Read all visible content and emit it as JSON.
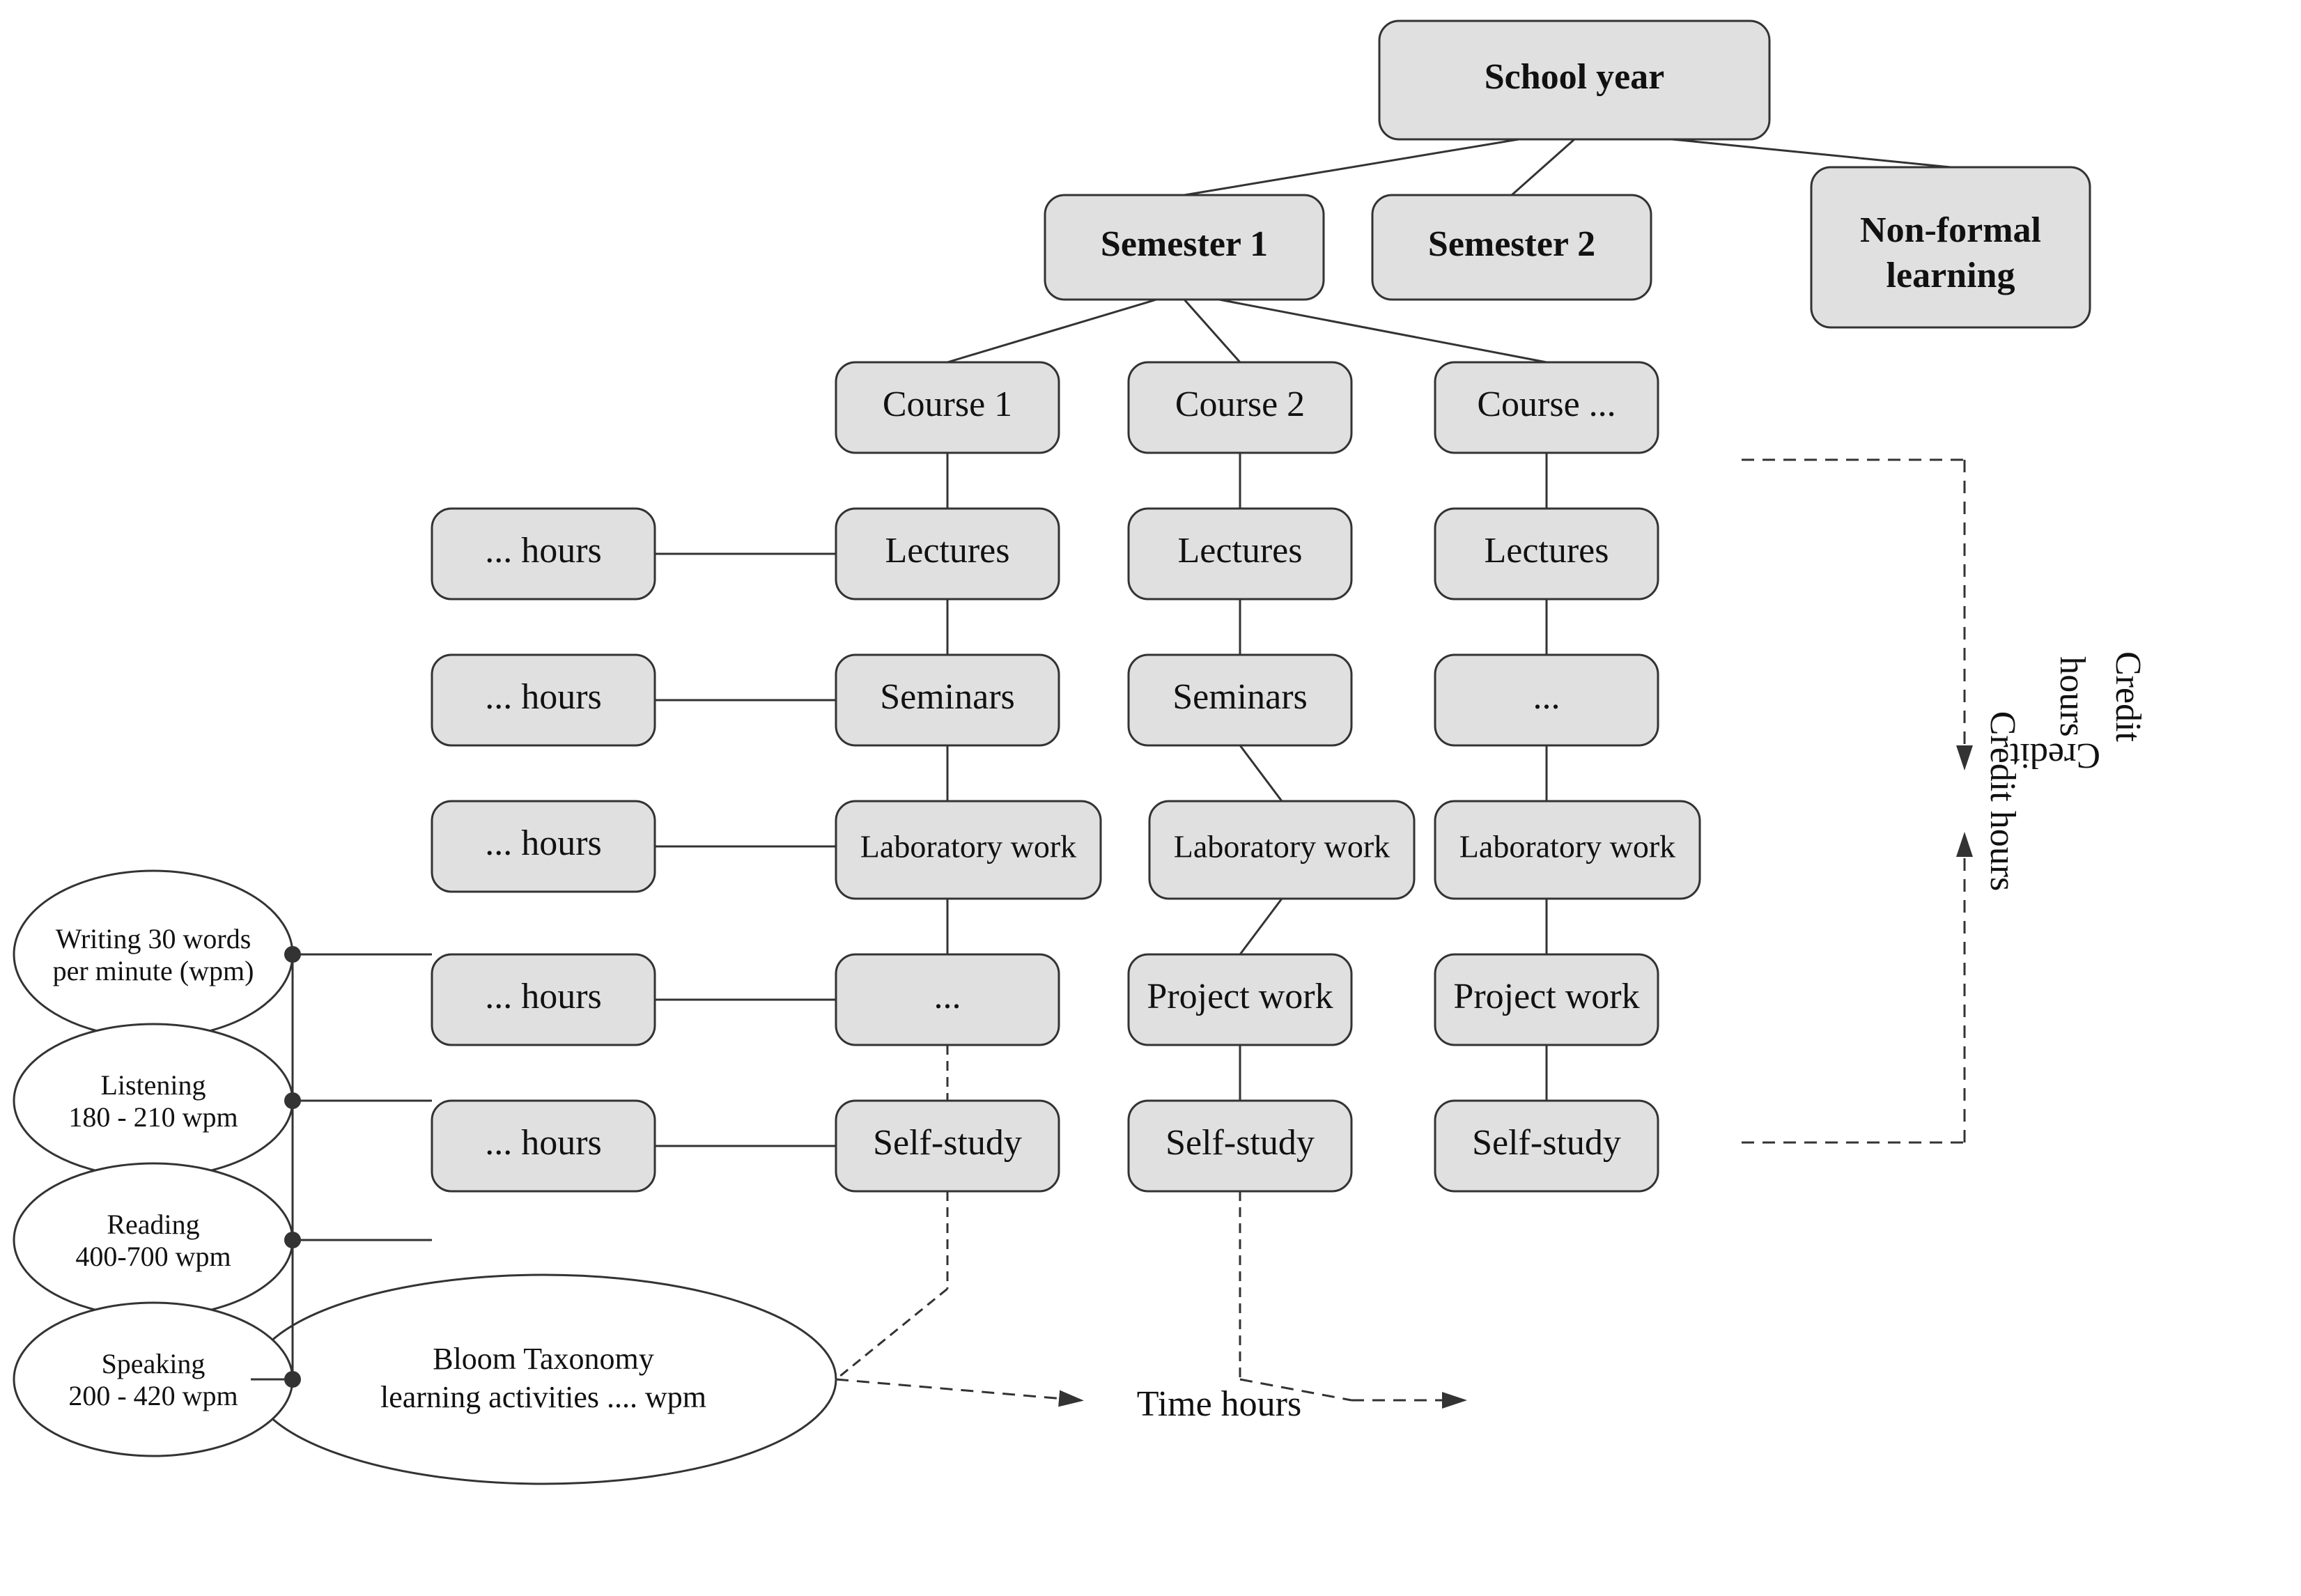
{
  "diagram": {
    "title": "School year",
    "nodes": {
      "school_year": {
        "label": "School year",
        "bold": true
      },
      "semester1": {
        "label": "Semester 1",
        "bold": true
      },
      "semester2": {
        "label": "Semester 2",
        "bold": true
      },
      "nonformal": {
        "label": "Non-formal\nlearning",
        "bold": true
      },
      "course1": {
        "label": "Course 1"
      },
      "course2": {
        "label": "Course 2"
      },
      "courseN": {
        "label": "Course ..."
      },
      "lectures1": {
        "label": "Lectures"
      },
      "lectures2": {
        "label": "Lectures"
      },
      "lecturesN": {
        "label": "Lectures"
      },
      "seminars1": {
        "label": "Seminars"
      },
      "seminars2": {
        "label": "Seminars"
      },
      "seminarsN": {
        "label": "..."
      },
      "lab1": {
        "label": "Laboratory work"
      },
      "lab2": {
        "label": "Laboratory work"
      },
      "labN": {
        "label": "Laboratory work"
      },
      "other1": {
        "label": "..."
      },
      "project2": {
        "label": "Project work"
      },
      "projectN": {
        "label": "Project work"
      },
      "selfstudy1": {
        "label": "Self-study"
      },
      "selfstudy2": {
        "label": "Self-study"
      },
      "selfstudyN": {
        "label": "Self-study"
      },
      "bloom": {
        "label": "Bloom Taxonomy\nlearning activities .... wpm"
      },
      "hours_lec": {
        "label": "... hours"
      },
      "hours_sem": {
        "label": "... hours"
      },
      "hours_lab": {
        "label": "... hours"
      },
      "hours_oth": {
        "label": "... hours"
      },
      "hours_ss": {
        "label": "... hours"
      },
      "writing": {
        "label": "Writing 30 words\nper minute (wpm)"
      },
      "listening": {
        "label": "Listening\n180 - 210 wpm"
      },
      "reading": {
        "label": "Reading\n400-700 wpm"
      },
      "speaking": {
        "label": "Speaking\n200 - 420 wpm"
      },
      "time_hours": {
        "label": "Time hours"
      },
      "credit_hours": {
        "label": "Credit\nhours"
      }
    }
  }
}
